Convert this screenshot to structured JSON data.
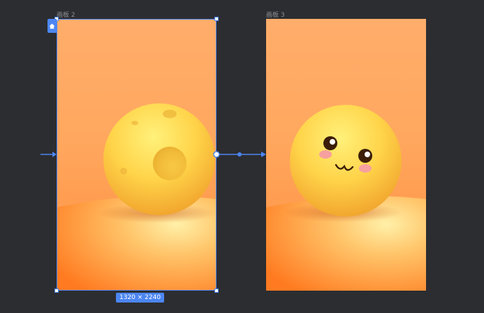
{
  "artboards": [
    {
      "label": "画板 2",
      "selected": true
    },
    {
      "label": "画板 3",
      "selected": false
    }
  ],
  "selection": {
    "size_label": "1320 × 2240"
  },
  "colors": {
    "accent": "#4c86f2",
    "canvas_bg": "#2c2d31",
    "label_text": "#8e8f94"
  },
  "icons": {
    "home": "home-icon"
  }
}
